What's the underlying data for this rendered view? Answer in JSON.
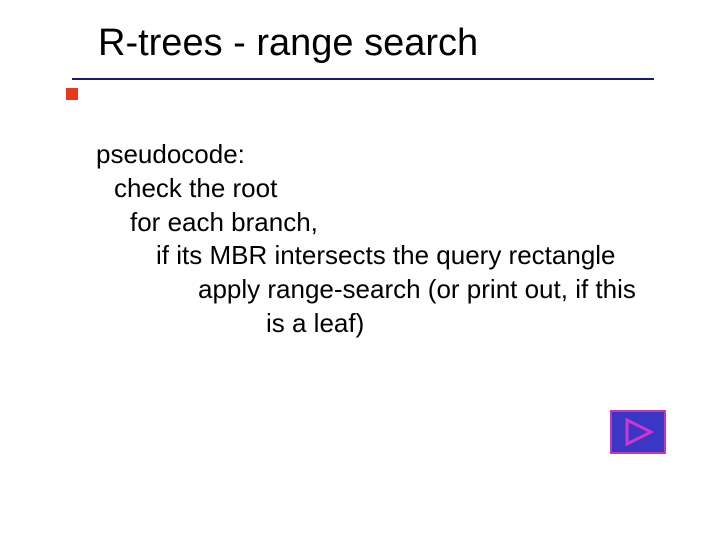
{
  "title": "R-trees - range search",
  "body": {
    "line0": "pseudocode:",
    "line1": "check the root",
    "line2": "for each branch,",
    "line3": "if its MBR intersects the query rectangle",
    "line4": "apply range-search (or print out, if this",
    "line5": "is a leaf)"
  },
  "icons": {
    "play": "play-icon"
  },
  "colors": {
    "rule": "#1a1a7a",
    "accent": "#e63a1a",
    "button_bg": "#3a37c4",
    "button_border": "#c236c0"
  }
}
